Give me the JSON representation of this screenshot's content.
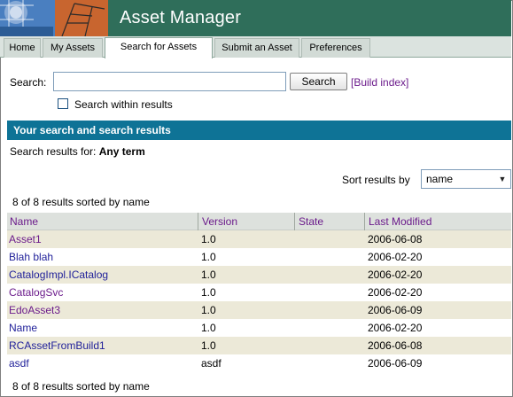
{
  "app": {
    "title": "Asset Manager"
  },
  "tabs": [
    {
      "label": "Home"
    },
    {
      "label": "My Assets"
    },
    {
      "label": "Search for Assets"
    },
    {
      "label": "Submit an Asset"
    },
    {
      "label": "Preferences"
    }
  ],
  "search": {
    "label": "Search:",
    "value": "",
    "placeholder": "",
    "button_label": "Search",
    "build_index_label": "[Build index]",
    "within_label": "Search within results"
  },
  "results": {
    "section_title": "Your search and search results",
    "for_label": "Search results for:",
    "for_value": "Any term",
    "sort_label": "Sort results by",
    "sort_value": "name",
    "count_text": "8 of 8 results sorted by name",
    "columns": [
      "Name",
      "Version",
      "State",
      "Last Modified"
    ],
    "rows": [
      {
        "name": "Asset1",
        "version": "1.0",
        "state": "",
        "modified": "2006-06-08"
      },
      {
        "name": "Blah blah",
        "version": "1.0",
        "state": "",
        "modified": "2006-02-20"
      },
      {
        "name": "CatalogImpl.ICatalog",
        "version": "1.0",
        "state": "",
        "modified": "2006-02-20"
      },
      {
        "name": "CatalogSvc",
        "version": "1.0",
        "state": "",
        "modified": "2006-02-20"
      },
      {
        "name": "EdoAsset3",
        "version": "1.0",
        "state": "",
        "modified": "2006-06-09"
      },
      {
        "name": "Name",
        "version": "1.0",
        "state": "",
        "modified": "2006-02-20"
      },
      {
        "name": "RCAssetFromBuild1",
        "version": "1.0",
        "state": "",
        "modified": "2006-06-08"
      },
      {
        "name": "asdf",
        "version": "asdf",
        "state": "",
        "modified": "2006-06-09"
      }
    ]
  },
  "colors": {
    "header_bg": "#2f6e5a",
    "section_bar": "#0e7396",
    "link": "#21219a",
    "visited_link": "#6b1b8b",
    "alt_row": "#ece9d8"
  },
  "icons": {
    "logo": "asset-manager-logo",
    "checkbox": "checkbox-icon",
    "dropdown": "chevron-down-icon"
  }
}
